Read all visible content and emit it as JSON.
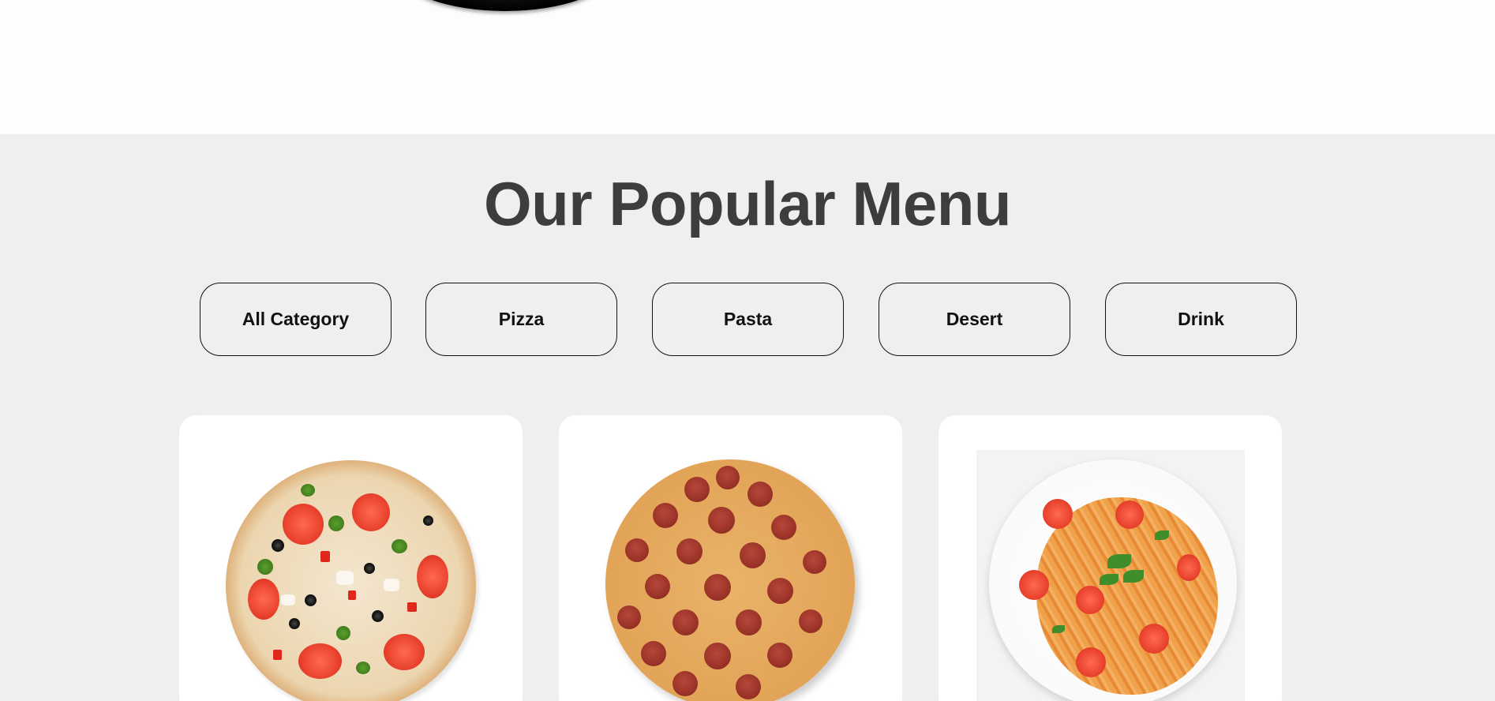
{
  "section": {
    "title": "Our Popular Menu"
  },
  "categories": [
    {
      "label": "All Category"
    },
    {
      "label": "Pizza"
    },
    {
      "label": "Pasta"
    },
    {
      "label": "Desert"
    },
    {
      "label": "Drink"
    }
  ],
  "cards": [
    {
      "image_alt": "vegetable pizza"
    },
    {
      "image_alt": "pepperoni pizza"
    },
    {
      "image_alt": "fusilli pasta with tomatoes"
    }
  ],
  "colors": {
    "section_background": "#efefef",
    "title": "#3d3d3d",
    "button_border": "#111111",
    "card_background": "#ffffff"
  }
}
